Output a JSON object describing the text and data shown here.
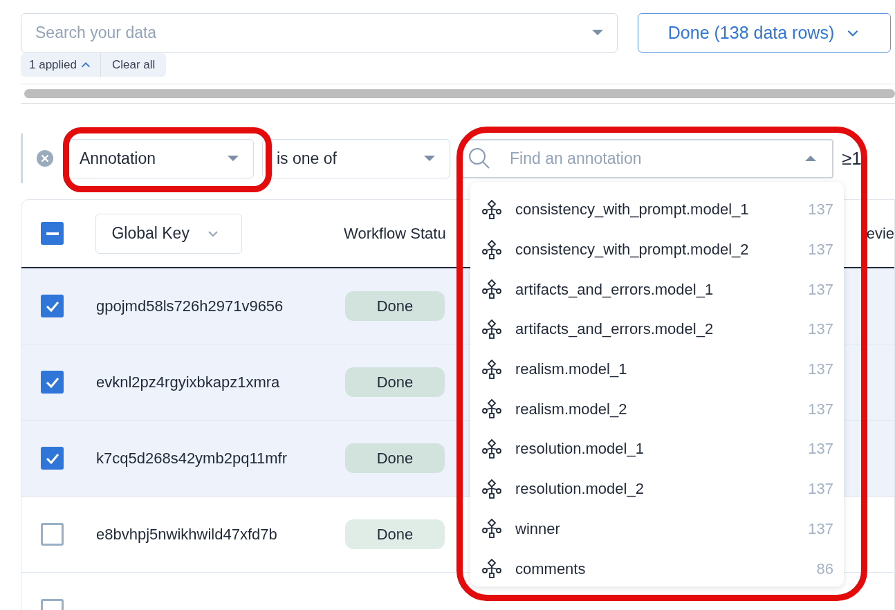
{
  "search": {
    "placeholder": "Search your data"
  },
  "view_button": {
    "label": "Done (138 data rows)"
  },
  "applied_chip": {
    "label": "1 applied",
    "expanded": true
  },
  "clear_chip": {
    "label": "Clear all"
  },
  "filter": {
    "field": "Annotation",
    "operator": "is one of",
    "value_search": {
      "placeholder": "Find an annotation",
      "expanded": true
    },
    "extra": "≥1"
  },
  "table": {
    "select_all": {
      "indeterminate": true
    },
    "columns": [
      "Global Key",
      "Workflow Statu",
      "evie"
    ],
    "rows": [
      {
        "global_key": "gpojmd58ls726h2971v9656",
        "status": "Done",
        "checked": true
      },
      {
        "global_key": "evknl2pz4rgyixbkapz1xmra",
        "status": "Done",
        "checked": true
      },
      {
        "global_key": "k7cq5d268s42ymb2pq11mfr",
        "status": "Done",
        "checked": true
      },
      {
        "global_key": "e8bvhpj5nwikhwild47xfd7b",
        "status": "Done",
        "checked": false
      },
      {
        "checked": false
      }
    ]
  },
  "annotation_menu": [
    {
      "name": "consistency_with_prompt.model_1",
      "count": "137"
    },
    {
      "name": "consistency_with_prompt.model_2",
      "count": "137"
    },
    {
      "name": "artifacts_and_errors.model_1",
      "count": "137"
    },
    {
      "name": "artifacts_and_errors.model_2",
      "count": "137"
    },
    {
      "name": "realism.model_1",
      "count": "137"
    },
    {
      "name": "realism.model_2",
      "count": "137"
    },
    {
      "name": "resolution.model_1",
      "count": "137"
    },
    {
      "name": "resolution.model_2",
      "count": "137"
    },
    {
      "name": "winner",
      "count": "137"
    },
    {
      "name": "comments",
      "count": "86"
    }
  ]
}
